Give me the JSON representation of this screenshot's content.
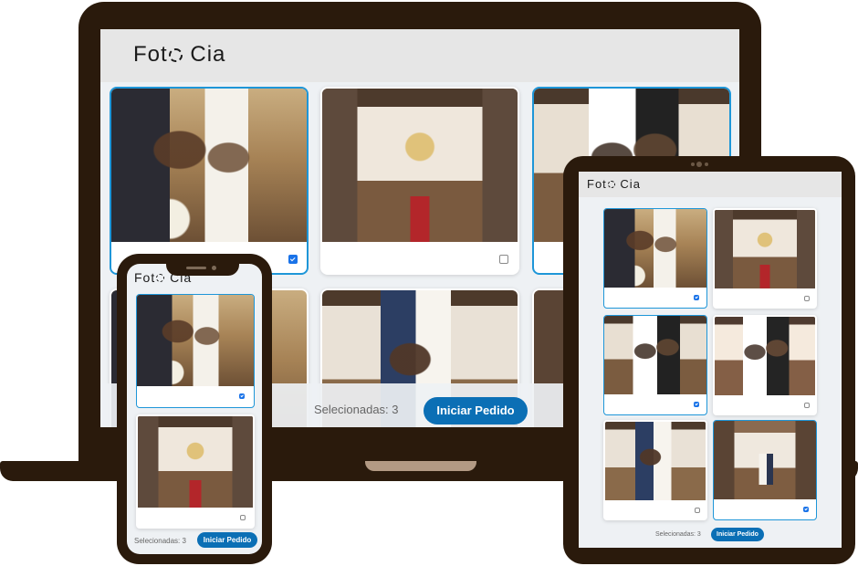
{
  "app": {
    "logo_text_1": "Fot",
    "logo_text_2": "Cia"
  },
  "laptop": {
    "photos": [
      {
        "subject": "bride-and-groom-portrait",
        "selected": true
      },
      {
        "subject": "church-aisle-wide",
        "selected": false
      },
      {
        "subject": "couple-close-up-vows",
        "selected": true
      },
      {
        "subject": "couple-portrait-partial",
        "selected": false
      },
      {
        "subject": "couple-kiss-aisle",
        "selected": false
      },
      {
        "subject": "ceremony-partial",
        "selected": false
      }
    ],
    "footer": {
      "selected_label": "Selecionadas: 3",
      "order_button": "Iniciar Pedido"
    }
  },
  "phone": {
    "photos": [
      {
        "subject": "bride-and-groom-portrait",
        "selected": true
      },
      {
        "subject": "church-aisle-wide",
        "selected": false
      }
    ],
    "footer": {
      "selected_label": "Selecionadas: 3",
      "order_button": "Iniciar Pedido"
    }
  },
  "tablet": {
    "photos": [
      {
        "subject": "bride-and-groom-portrait",
        "selected": true
      },
      {
        "subject": "church-aisle-wide",
        "selected": false
      },
      {
        "subject": "couple-close-up-vows",
        "selected": true
      },
      {
        "subject": "bride-with-bouquet",
        "selected": false
      },
      {
        "subject": "couple-kiss-aisle",
        "selected": false
      },
      {
        "subject": "couple-walking-aisle",
        "selected": true
      }
    ],
    "footer": {
      "selected_label": "Selecionadas: 3",
      "order_button": "Iniciar Pedido"
    }
  },
  "colors": {
    "accent": "#0b6fb5",
    "selected_border": "#1e96d8",
    "device_frame": "#2a1a0c",
    "checkbox_checked": "#1a73e8"
  }
}
